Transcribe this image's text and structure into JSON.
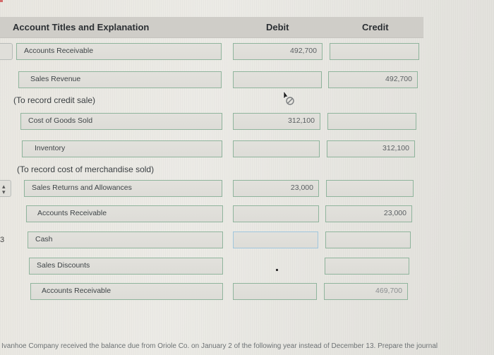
{
  "header": {
    "account_col": "Account Titles and Explanation",
    "debit_col": "Debit",
    "credit_col": "Credit"
  },
  "entries": [
    {
      "rows": [
        {
          "account": "Accounts Receivable",
          "debit": "492,700",
          "credit": ""
        },
        {
          "account": "Sales Revenue",
          "debit": "",
          "credit": "492,700"
        }
      ],
      "explanation": "(To record credit sale)"
    },
    {
      "rows": [
        {
          "account": "Cost of Goods Sold",
          "debit": "312,100",
          "credit": ""
        },
        {
          "account": "Inventory",
          "debit": "",
          "credit": "312,100"
        }
      ],
      "explanation": "(To record cost of merchandise sold)"
    },
    {
      "rows": [
        {
          "account": "Sales Returns and Allowances",
          "debit": "23,000",
          "credit": ""
        },
        {
          "account": "Accounts Receivable",
          "debit": "",
          "credit": "23,000"
        }
      ]
    },
    {
      "label_fragment": "3",
      "rows": [
        {
          "account": "Cash",
          "debit": "",
          "credit": ""
        },
        {
          "account": "Sales Discounts",
          "credit": ""
        },
        {
          "account": "Accounts Receivable",
          "debit": "",
          "credit": "469,700"
        }
      ]
    }
  ],
  "icons": {
    "stepper": "up-down-stepper-icon",
    "cursor": "not-allowed-cursor-icon"
  },
  "footer": {
    "text": "Ivanhoe Company received the balance due from Oriole Co. on January 2 of the following year instead of December 13. Prepare the journal"
  },
  "colors": {
    "box_border": "#8fb49c",
    "focus_border": "#9fc6dc",
    "header_bg": "#cfcdc8"
  }
}
